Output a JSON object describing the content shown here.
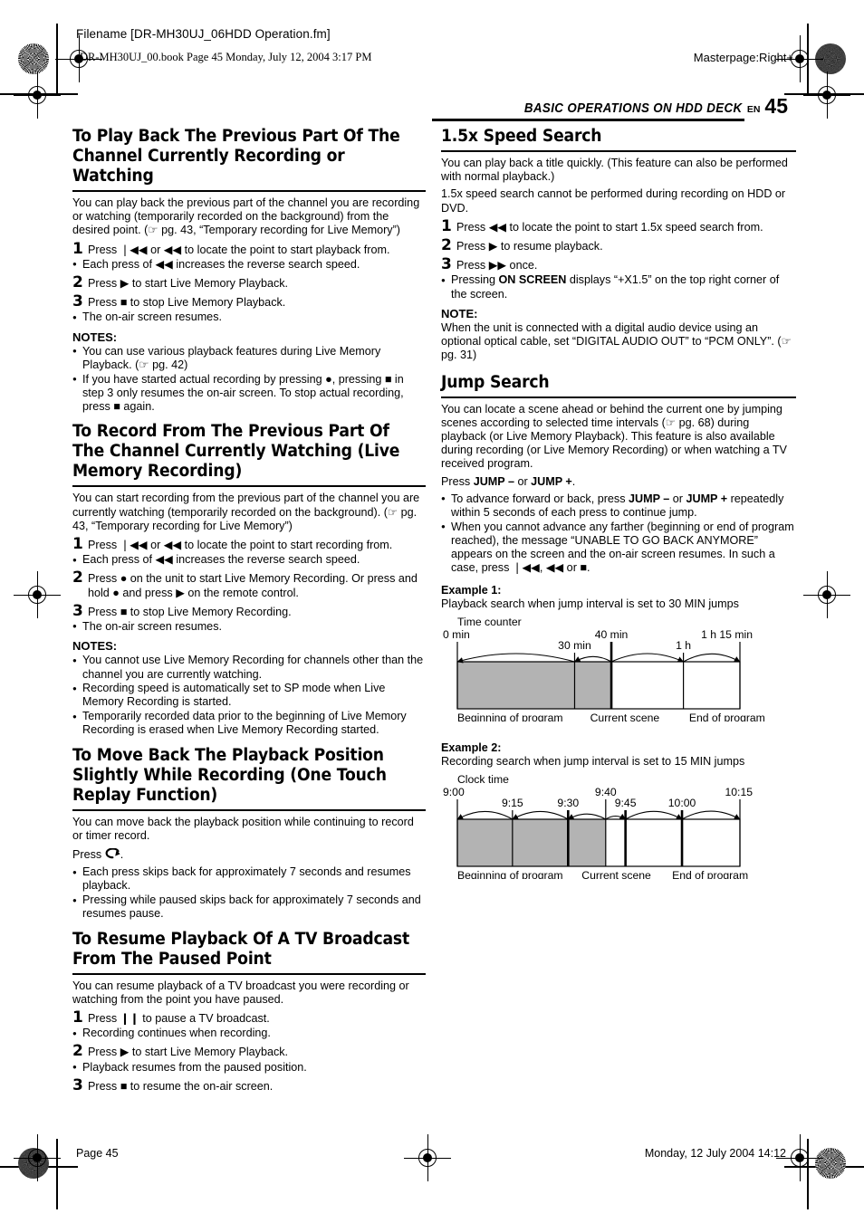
{
  "page": {
    "header": {
      "filename": "Filename [DR-MH30UJ_06HDD Operation.fm]",
      "bookline": "DR-MH30UJ_00.book  Page 45  Monday, July 12, 2004  3:17 PM",
      "masterpage": "Masterpage:Right+"
    },
    "running_head": {
      "title": "BASIC OPERATIONS ON HDD DECK",
      "lang": "EN",
      "number": "45"
    },
    "footer": {
      "page": "Page 45",
      "date": "Monday, 12 July 2004  14:12"
    }
  },
  "left_column": {
    "sections": [
      {
        "heading": "To Play Back The Previous Part Of The Channel Currently Recording or Watching",
        "intro": "You can play back the previous part of the channel you are recording or watching (temporarily recorded on the background) from the desired point. (☞ pg. 43, “Temporary recording for Live Memory”)",
        "steps": [
          {
            "num": "1",
            "text": "Press ❘◀◀ or ◀◀ to locate the point to start playback from."
          },
          {
            "num": "2",
            "text": "Press ▶ to start Live Memory Playback."
          },
          {
            "num": "3",
            "text": "Press ■ to stop Live Memory Playback."
          }
        ],
        "bullets_after_step1": [
          "Each press of ◀◀ increases the reverse search speed."
        ],
        "bullets_after_step3": [
          "The on-air screen resumes."
        ],
        "notes_label": "NOTES:",
        "notes": [
          "You can use various playback features during Live Memory Playback. (☞ pg. 42)",
          "If you have started actual recording by pressing ●, pressing ■ in step 3 only resumes the on-air screen. To stop actual recording, press ■ again."
        ]
      },
      {
        "heading": "To Record From The Previous Part Of The Channel Currently Watching (Live Memory Recording)",
        "intro": "You can start recording from the previous part of the channel you are currently watching (temporarily recorded on the background). (☞ pg. 43, “Temporary recording for Live Memory”)",
        "steps": [
          {
            "num": "1",
            "text": "Press ❘◀◀ or ◀◀ to locate the point to start recording from."
          },
          {
            "num": "2",
            "text": "Press ● on the unit to start Live Memory Recording. Or press and hold ● and press ▶ on the remote control."
          },
          {
            "num": "3",
            "text": "Press ■ to stop Live Memory Recording."
          }
        ],
        "bullets_after_step1": [
          "Each press of ◀◀ increases the reverse search speed."
        ],
        "bullets_after_step3": [
          "The on-air screen resumes."
        ],
        "notes_label": "NOTES:",
        "notes": [
          "You cannot use Live Memory Recording for channels other than the channel you are currently watching.",
          "Recording speed is automatically set to SP mode when Live Memory Recording is started.",
          "Temporarily recorded data prior to the beginning of Live Memory Recording is erased when Live Memory Recording started."
        ]
      },
      {
        "heading": "To Move Back The Playback Position Slightly While Recording (One Touch Replay Function)",
        "intro": "You can move back the playback position while continuing to record or timer record.",
        "press_line": "Press",
        "press_suffix": ".",
        "bullets": [
          "Each press skips back for approximately 7 seconds and resumes playback.",
          "Pressing while paused skips back for approximately 7 seconds and resumes pause."
        ]
      },
      {
        "heading": "To Resume Playback Of A TV Broadcast From The Paused Point",
        "intro": "You can resume playback of a TV broadcast you were recording or watching from the point you have paused.",
        "steps": [
          {
            "num": "1",
            "text": "Press ❙❙ to pause a TV broadcast."
          },
          {
            "num": "2",
            "text": "Press ▶ to start Live Memory Playback."
          },
          {
            "num": "3",
            "text": "Press ■ to resume the on-air screen."
          }
        ],
        "bullets_after_step1": [
          "Recording continues when recording."
        ],
        "bullets_after_step2": [
          "Playback resumes from the paused position."
        ]
      }
    ]
  },
  "right_column": {
    "sections": [
      {
        "heading": "1.5x Speed Search",
        "intro_lines": [
          "You can play back a title quickly. (This feature can also be performed with normal playback.)",
          "1.5x speed search cannot be performed during recording on HDD or DVD."
        ],
        "steps": [
          {
            "num": "1",
            "text": "Press ◀◀ to locate the point to start 1.5x speed search from."
          },
          {
            "num": "2",
            "text": "Press ▶ to resume playback."
          },
          {
            "num": "3",
            "text": "Press ▶▶ once."
          }
        ],
        "bullets_after_step3": [
          "Pressing ON SCREEN displays “+X1.5” on the top right corner of the screen."
        ],
        "note_label": "NOTE:",
        "note_text": "When the unit is connected with a digital audio device using an optional optical cable, set “DIGITAL AUDIO OUT” to “PCM ONLY”. (☞ pg. 31)"
      },
      {
        "heading": "Jump Search",
        "intro": "You can locate a scene ahead or behind the current one by jumping scenes according to selected time intervals (☞ pg. 68) during playback (or Live Memory Playback). This feature is also available during recording (or Live Memory Recording) or when watching a TV received program.",
        "press_line": "Press JUMP – or JUMP +.",
        "bullets": [
          "To advance forward or back, press JUMP – or JUMP + repeatedly within 5 seconds of each press to continue jump.",
          "When you cannot advance any farther (beginning or end of program reached), the message “UNABLE TO GO BACK ANYMORE” appears on the screen and the on-air screen resumes. In such a case, press ❘◀◀, ◀◀ or ■."
        ]
      }
    ],
    "examples": [
      {
        "label": "Example 1:",
        "description": "Playback search when jump interval is set to 30 MIN jumps"
      },
      {
        "label": "Example 2:",
        "description": "Recording search when jump interval is set to 15 MIN jumps"
      }
    ]
  },
  "chart_data": [
    {
      "type": "timeline",
      "title": "Example 1: Playback search when jump interval is set to 30 MIN jumps",
      "axis_label": "Time counter",
      "ticks": [
        {
          "label": "0 min",
          "x": 0,
          "level": "top",
          "bold": false
        },
        {
          "label": "30 min",
          "x": 0.415,
          "level": "bottom",
          "bold": false
        },
        {
          "label": "40 min",
          "x": 0.545,
          "level": "top",
          "bold": true
        },
        {
          "label": "1 h",
          "x": 0.8,
          "level": "bottom",
          "bold": false
        },
        {
          "label": "1 h 15 min",
          "x": 1.0,
          "level": "top",
          "bold": false
        }
      ],
      "shaded_until": 0.545,
      "jump_arcs": [
        {
          "from": 0.415,
          "to": 0.0,
          "dir": "back"
        },
        {
          "from": 0.545,
          "to": 0.415,
          "dir": "back"
        },
        {
          "from": 0.545,
          "to": 0.8,
          "dir": "fwd"
        },
        {
          "from": 0.8,
          "to": 1.0,
          "dir": "fwd"
        }
      ],
      "captions": [
        {
          "text": "Beginning of program",
          "x": 0.0
        },
        {
          "text": "Current scene",
          "x": 0.47
        },
        {
          "text": "End of program",
          "x": 0.82
        }
      ]
    },
    {
      "type": "timeline",
      "title": "Example 2: Recording search when jump interval is set to 15 MIN jumps",
      "axis_label": "Clock time",
      "ticks": [
        {
          "label": "9:00",
          "x": 0.0,
          "level": "top",
          "bold": false
        },
        {
          "label": "9:15",
          "x": 0.195,
          "level": "bottom",
          "bold": false
        },
        {
          "label": "9:30",
          "x": 0.392,
          "level": "bottom",
          "bold": true
        },
        {
          "label": "9:40",
          "x": 0.525,
          "level": "top",
          "bold": false
        },
        {
          "label": "9:45",
          "x": 0.595,
          "level": "bottom",
          "bold": true
        },
        {
          "label": "10:00",
          "x": 0.795,
          "level": "bottom",
          "bold": true
        },
        {
          "label": "10:15",
          "x": 1.0,
          "level": "top",
          "bold": false
        }
      ],
      "shaded_until": 0.525,
      "jump_arcs": [
        {
          "from": 0.195,
          "to": 0.0,
          "dir": "back"
        },
        {
          "from": 0.392,
          "to": 0.195,
          "dir": "back"
        },
        {
          "from": 0.525,
          "to": 0.392,
          "dir": "back"
        },
        {
          "from": 0.525,
          "to": 0.595,
          "dir": "fwd"
        },
        {
          "from": 0.595,
          "to": 0.795,
          "dir": "fwd"
        },
        {
          "from": 0.795,
          "to": 1.0,
          "dir": "fwd"
        }
      ],
      "captions": [
        {
          "text": "Beginning of program",
          "x": 0.0
        },
        {
          "text": "Current scene",
          "x": 0.44
        },
        {
          "text": "End of program",
          "x": 0.76
        }
      ]
    }
  ],
  "colors": {
    "shade": "#b3b3b3",
    "ink": "#000000",
    "paper": "#ffffff"
  }
}
